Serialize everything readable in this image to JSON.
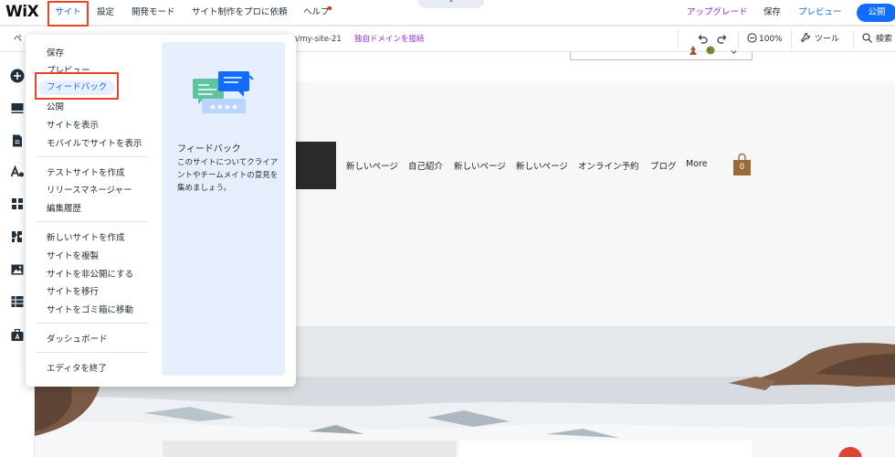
{
  "topbar": {
    "logo": "WiX",
    "menu": {
      "site": "サイト",
      "settings": "設定",
      "dev_mode": "開発モード",
      "hire_pro": "サイト制作をプロに依頼",
      "help": "ヘルプ"
    },
    "upgrade": "アップグレード",
    "save": "保存",
    "preview": "プレビュー",
    "publish": "公開",
    "collapse_arrow": "⌃"
  },
  "subbar": {
    "page_label": "ペ",
    "url_suffix": "om/my-site-21",
    "domain_link": "独自ドメインを接続",
    "zoom": "100%",
    "tools": "ツール",
    "search": "検索"
  },
  "dropdown": {
    "group1": [
      "保存",
      "プレビュー",
      "フィードバック",
      "公開",
      "サイトを表示",
      "モバイルでサイトを表示"
    ],
    "group2": [
      "テストサイトを作成",
      "リリースマネージャー",
      "編集履歴"
    ],
    "group3": [
      "新しいサイトを作成",
      "サイトを複製",
      "サイトを非公開にする",
      "サイトを移行",
      "サイトをゴミ箱に移動"
    ],
    "group4": [
      "ダッシュボード"
    ],
    "group5": [
      "エディタを終了"
    ],
    "panel": {
      "title": "フィードバック",
      "description": "このサイトについてクライアントやチームメイトの意見を集めましょう。"
    }
  },
  "canvas": {
    "nav": [
      "新しいページ",
      "自己紹介",
      "新しいページ",
      "新しいページ",
      "オンライン予約",
      "ブログ",
      "More"
    ],
    "cart_count": "0"
  },
  "colors": {
    "accent_blue": "#116dff",
    "upgrade_purple": "#9a27d5",
    "highlight_red": "#e8442a"
  }
}
